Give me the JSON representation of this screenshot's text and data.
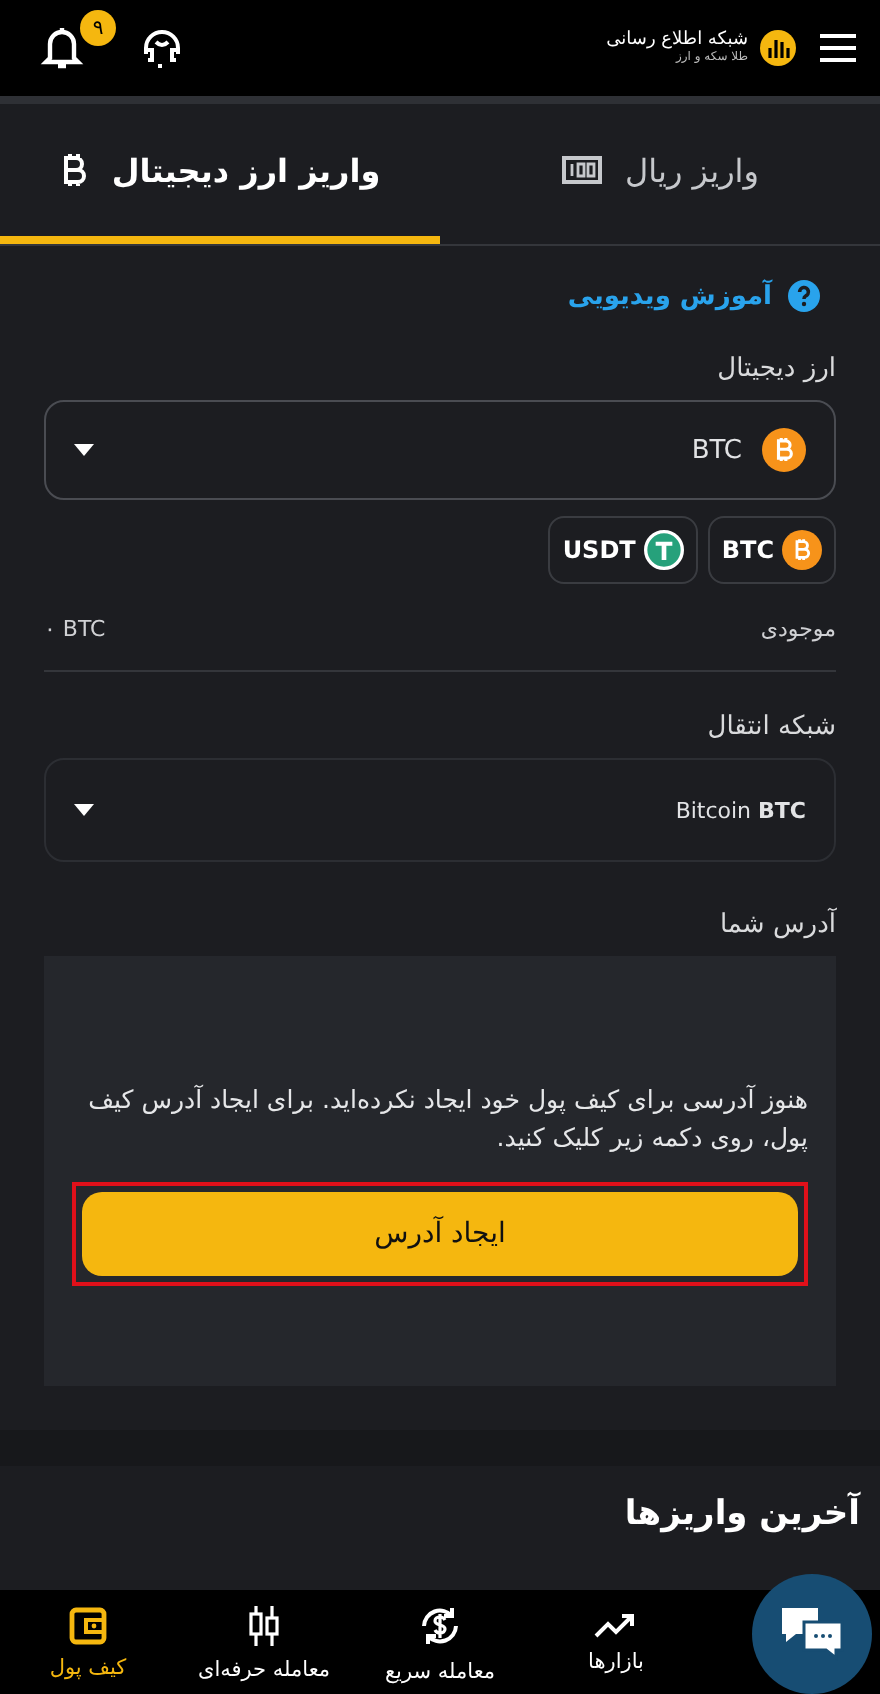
{
  "header": {
    "logo_title": "شبکه اطلاع رسانی",
    "logo_subtitle": "طلا سکه و ارز",
    "notification_count": "۹"
  },
  "tabs": [
    {
      "label": "واریز ریال",
      "selected": false
    },
    {
      "label": "واریز ارز دیجیتال",
      "selected": true
    }
  ],
  "video_help": "آموزش ویدیویی",
  "currency": {
    "label": "ارز دیجیتال",
    "value": "BTC"
  },
  "quick_picks": [
    {
      "label": "BTC"
    },
    {
      "label": "USDT"
    }
  ],
  "balance": {
    "label": "موجودی",
    "value": "۰ BTC"
  },
  "network": {
    "label": "شبکه انتقال",
    "value": "Bitcoin **BTC**"
  },
  "address": {
    "label": "آدرس شما",
    "message": "هنوز آدرسی برای کیف پول خود ایجاد نکرده‌اید. برای ایجاد آدرس کیف پول، روی دکمه زیر کلیک کنید.",
    "button": "ایجاد آدرس",
    "highlighted": true
  },
  "recent_title": "آخرین واریزها",
  "nav": [
    {
      "label": "بازارها",
      "selected": false
    },
    {
      "label": "معامله سریع",
      "selected": false
    },
    {
      "label": "معامله حرفه‌ای",
      "selected": false
    },
    {
      "label": "کیف پول",
      "selected": true
    }
  ]
}
